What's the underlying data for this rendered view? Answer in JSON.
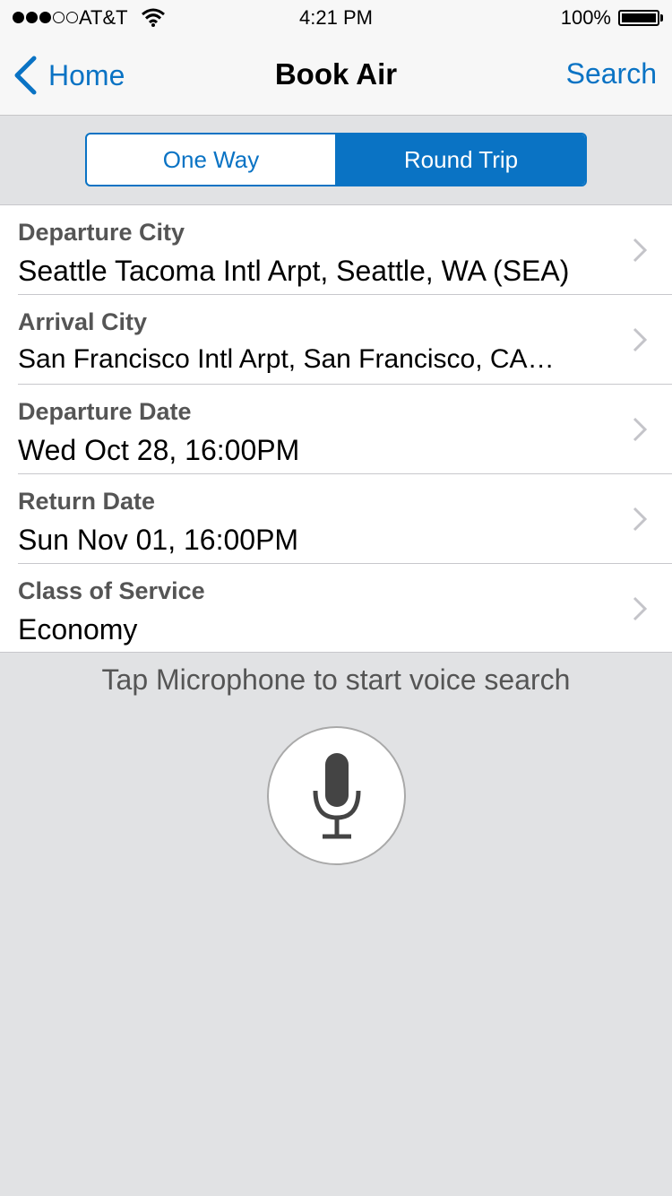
{
  "status_bar": {
    "carrier": "AT&T",
    "time": "4:21 PM",
    "battery": "100%",
    "signal_bars": 3,
    "signal_total": 5
  },
  "nav": {
    "back_label": "Home",
    "title": "Book Air",
    "search_label": "Search"
  },
  "trip_type": {
    "options": [
      "One Way",
      "Round Trip"
    ],
    "selected": "Round Trip"
  },
  "form": {
    "rows": [
      {
        "label": "Departure City",
        "value": "Seattle Tacoma Intl Arpt, Seattle, WA (SEA)"
      },
      {
        "label": "Arrival City",
        "value": "San Francisco Intl Arpt, San Francisco, CA…"
      },
      {
        "label": "Departure Date",
        "value": "Wed Oct 28, 16:00PM"
      },
      {
        "label": "Return Date",
        "value": "Sun Nov 01, 16:00PM"
      },
      {
        "label": "Class of Service",
        "value": "Economy"
      }
    ]
  },
  "voice": {
    "hint": "Tap Microphone to start voice search",
    "icon": "microphone-icon"
  },
  "colors": {
    "accent": "#0a73c4",
    "background": "#e1e2e4",
    "label": "#555555"
  }
}
